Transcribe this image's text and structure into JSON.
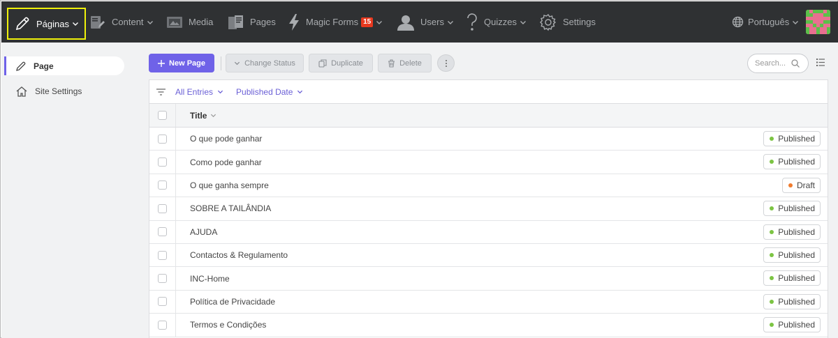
{
  "topbar": {
    "nav": [
      {
        "label": "Páginas",
        "icon": "pencil-icon",
        "dropdown": true,
        "active": true
      },
      {
        "label": "Content",
        "icon": "content-icon",
        "dropdown": true
      },
      {
        "label": "Media",
        "icon": "media-icon",
        "dropdown": false
      },
      {
        "label": "Pages",
        "icon": "pages-icon",
        "dropdown": false
      },
      {
        "label": "Magic Forms",
        "icon": "lightning-icon",
        "dropdown": true,
        "badge": "15"
      },
      {
        "label": "Users",
        "icon": "user-icon",
        "dropdown": true
      },
      {
        "label": "Quizzes",
        "icon": "question-icon",
        "dropdown": true
      },
      {
        "label": "Settings",
        "icon": "gear-icon",
        "dropdown": false
      }
    ],
    "language": "Português",
    "colors": {
      "bar": "#2f3133",
      "active_outline": "#f0f20a",
      "badge": "#e8391f"
    }
  },
  "sidebar": {
    "items": [
      {
        "label": "Page",
        "icon": "pencil-icon",
        "active": true
      },
      {
        "label": "Site Settings",
        "icon": "home-icon",
        "active": false
      }
    ]
  },
  "toolbar": {
    "new_page": "New Page",
    "change_status": "Change Status",
    "duplicate": "Duplicate",
    "delete": "Delete",
    "search_placeholder": "Search..."
  },
  "filters": {
    "entries": "All Entries",
    "published_date": "Published Date"
  },
  "table": {
    "column_title": "Title",
    "rows": [
      {
        "title": "O que pode ganhar",
        "status": "Published",
        "status_color": "#7cc443"
      },
      {
        "title": "Como pode ganhar",
        "status": "Published",
        "status_color": "#7cc443"
      },
      {
        "title": "O que ganha sempre",
        "status": "Draft",
        "status_color": "#f07c2e"
      },
      {
        "title": "SOBRE A TAILÂNDIA",
        "status": "Published",
        "status_color": "#7cc443"
      },
      {
        "title": "AJUDA",
        "status": "Published",
        "status_color": "#7cc443"
      },
      {
        "title": "Contactos & Regulamento",
        "status": "Published",
        "status_color": "#7cc443"
      },
      {
        "title": "INC-Home",
        "status": "Published",
        "status_color": "#7cc443"
      },
      {
        "title": "Política de Privacidade",
        "status": "Published",
        "status_color": "#7cc443"
      },
      {
        "title": "Termos e Condições",
        "status": "Published",
        "status_color": "#7cc443"
      }
    ]
  },
  "accent_color": "#6f62e8"
}
